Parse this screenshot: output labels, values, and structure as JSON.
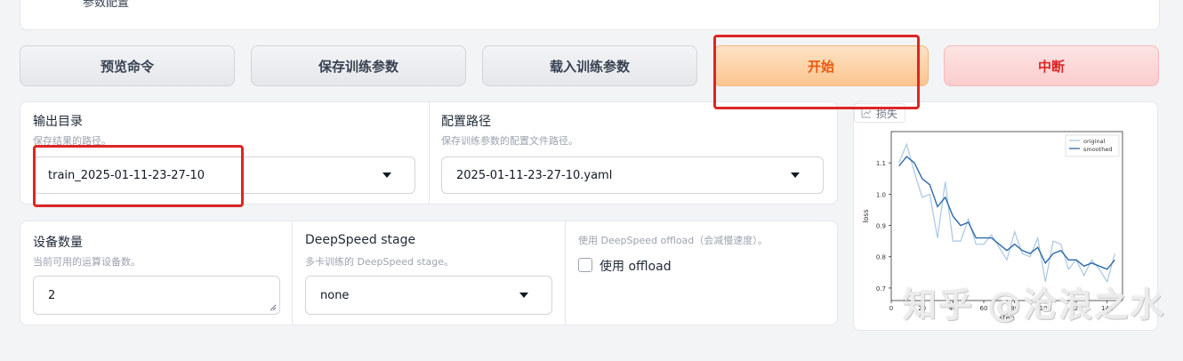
{
  "top_section": {
    "label_fragment": "参数配置"
  },
  "actions": {
    "preview": "预览命令",
    "save": "保存训练参数",
    "load": "载入训练参数",
    "start": "开始",
    "abort": "中断"
  },
  "output_dir": {
    "title": "输出目录",
    "info": "保存结果的路径。",
    "value": "train_2025-01-11-23-27-10"
  },
  "config_path": {
    "title": "配置路径",
    "info": "保存训练参数的配置文件路径。",
    "value": "2025-01-11-23-27-10.yaml"
  },
  "device_count": {
    "title": "设备数量",
    "info": "当前可用的运算设备数。",
    "value": "2"
  },
  "ds_stage": {
    "title": "DeepSpeed stage",
    "info": "多卡训练的 DeepSpeed stage。",
    "value": "none"
  },
  "ds_offload": {
    "info": "使用 DeepSpeed offload（会减慢速度）。",
    "label": "使用 offload",
    "checked": false
  },
  "loss_plot": {
    "tag": "损失",
    "chart_data": {
      "type": "line",
      "xlabel": "step",
      "ylabel": "loss",
      "xlim": [
        0,
        150
      ],
      "ylim": [
        0.66,
        1.2
      ],
      "xticks": [
        "0",
        "20",
        "40",
        "60",
        "80",
        "100",
        "120",
        "140"
      ],
      "yticks": [
        "0.7",
        "0.8",
        "0.9",
        "1.0",
        "1.1"
      ],
      "legend_position": "top-right",
      "series": [
        {
          "name": "original",
          "color": "#a9c6e3",
          "x": [
            5,
            10,
            15,
            20,
            25,
            30,
            35,
            40,
            45,
            50,
            55,
            60,
            65,
            70,
            75,
            80,
            85,
            90,
            95,
            100,
            105,
            110,
            115,
            120,
            125,
            130,
            135,
            140,
            145
          ],
          "values": [
            1.1,
            1.16,
            1.07,
            0.99,
            1.0,
            0.86,
            1.04,
            0.85,
            0.85,
            0.92,
            0.84,
            0.84,
            0.87,
            0.83,
            0.79,
            0.88,
            0.81,
            0.8,
            0.86,
            0.72,
            0.85,
            0.84,
            0.76,
            0.79,
            0.74,
            0.79,
            0.76,
            0.72,
            0.81
          ]
        },
        {
          "name": "smoothed",
          "color": "#2f6aa8",
          "x": [
            5,
            10,
            15,
            20,
            25,
            30,
            35,
            40,
            45,
            50,
            55,
            60,
            65,
            70,
            75,
            80,
            85,
            90,
            95,
            100,
            105,
            110,
            115,
            120,
            125,
            130,
            135,
            140,
            145
          ],
          "values": [
            1.09,
            1.12,
            1.1,
            1.05,
            1.03,
            0.96,
            0.99,
            0.93,
            0.9,
            0.91,
            0.86,
            0.86,
            0.86,
            0.84,
            0.82,
            0.84,
            0.82,
            0.81,
            0.83,
            0.78,
            0.81,
            0.82,
            0.79,
            0.79,
            0.77,
            0.78,
            0.77,
            0.76,
            0.79
          ]
        }
      ]
    }
  },
  "watermark": "知乎 @沧浪之水",
  "colors": {
    "highlight": "#dc2626",
    "start_text": "#ea580c",
    "abort_text": "#dc2626"
  }
}
